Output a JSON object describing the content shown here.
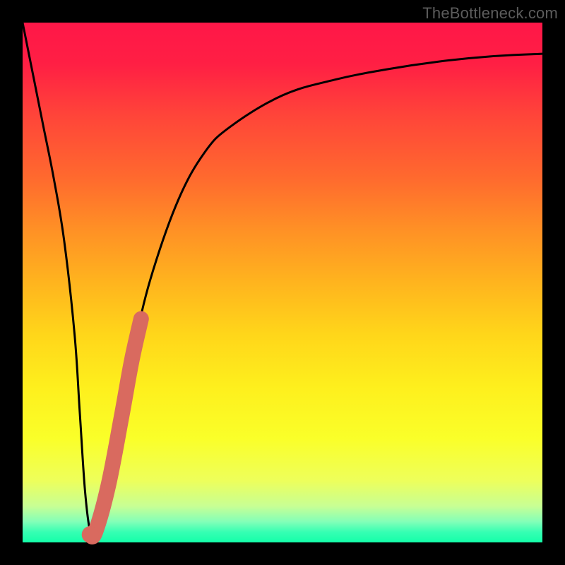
{
  "watermark": "TheBottleneck.com",
  "colors": {
    "frame": "#000000",
    "curve": "#000000",
    "highlight": "#d96a5f"
  },
  "chart_data": {
    "type": "line",
    "title": "",
    "xlabel": "",
    "ylabel": "",
    "xlim": [
      0,
      100
    ],
    "ylim": [
      0,
      100
    ],
    "grid": false,
    "series": [
      {
        "name": "bottleneck-curve",
        "color": "#000000",
        "x": [
          0,
          2,
          4,
          6,
          8,
          10,
          11,
          12,
          13,
          14,
          16,
          18,
          20,
          22,
          25,
          30,
          35,
          40,
          50,
          60,
          70,
          80,
          90,
          100
        ],
        "y": [
          100,
          90,
          80,
          70,
          58,
          40,
          25,
          10,
          2,
          1,
          5,
          15,
          28,
          40,
          52,
          66,
          75,
          80,
          86,
          89,
          91,
          92.5,
          93.5,
          94
        ]
      },
      {
        "name": "highlight-segment",
        "color": "#d96a5f",
        "x": [
          13.0,
          14.0,
          16.5,
          19.0,
          21.0,
          22.8
        ],
        "y": [
          1.5,
          2.0,
          11.0,
          24.0,
          35.0,
          43.0
        ]
      }
    ],
    "annotations": []
  }
}
